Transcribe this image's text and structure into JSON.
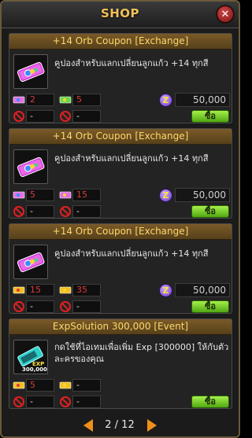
{
  "window": {
    "title": "SHOP"
  },
  "items": [
    {
      "name": "+14 Orb Coupon [Exchange]",
      "desc": "คูปองสำหรับแลกเปลี่ยนลูกแก้ว +14 ทุกสี",
      "stat1": "2",
      "stat2": "5",
      "price": "50,000",
      "buy_label": "ซื้อ",
      "restrict1": "-",
      "restrict2": "-"
    },
    {
      "name": "+14 Orb Coupon [Exchange]",
      "desc": "คูปองสำหรับแลกเปลี่ยนลูกแก้ว +14 ทุกสี",
      "stat1": "5",
      "stat2": "15",
      "price": "50,000",
      "buy_label": "ซื้อ",
      "restrict1": "-",
      "restrict2": "-"
    },
    {
      "name": "+14 Orb Coupon [Exchange]",
      "desc": "คูปองสำหรับแลกเปลี่ยนลูกแก้ว +14 ทุกสี",
      "stat1": "15",
      "stat2": "35",
      "price": "50,000",
      "buy_label": "ซื้อ",
      "restrict1": "-",
      "restrict2": "-"
    },
    {
      "name": "ExpSolution 300,000 [Event]",
      "desc": "กดใช้ที่ไอเทมเพื่อเพิ่ม Exp [300000] ให้กับตัวละครของคุณ",
      "stat1": "5",
      "stat2": "-",
      "buy_label": "ซื้อ",
      "restrict1": "-",
      "restrict2": "-",
      "icon_text1": "EXP",
      "icon_text2": "300,000"
    }
  ],
  "pager": {
    "current": "2 / 12"
  },
  "colors": {
    "accent": "#f2c25a",
    "buy": "#7fd42a",
    "header": "#6a4e22"
  }
}
